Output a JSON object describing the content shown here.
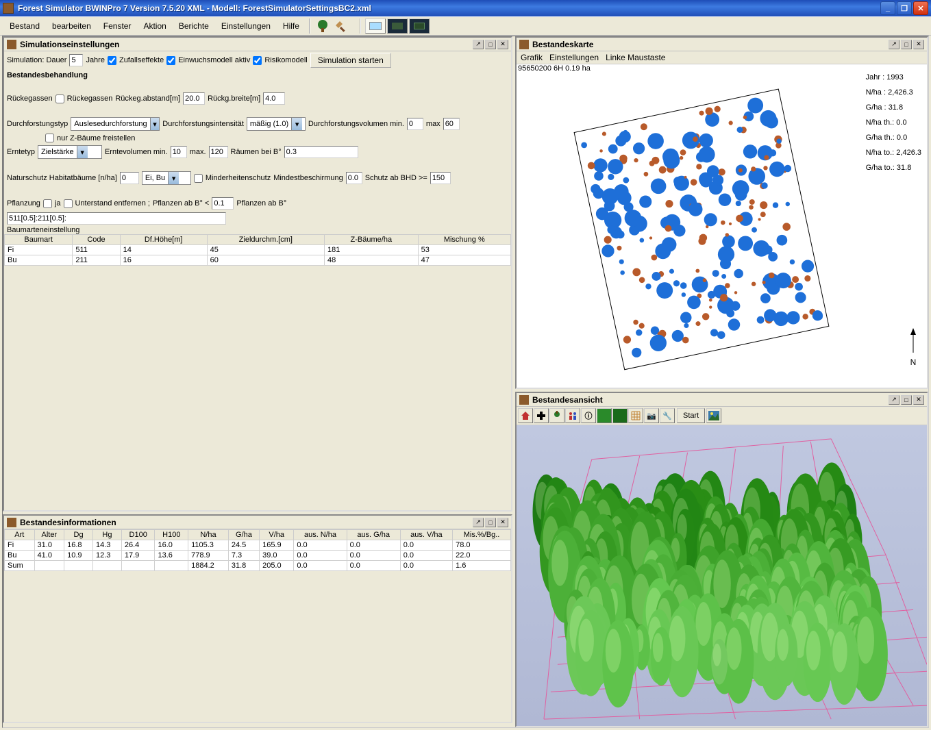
{
  "window": {
    "title": "Forest Simulator BWINPro 7 Version 7.5.20 XML - Modell: ForestSimulatorSettingsBC2.xml"
  },
  "menubar": [
    "Bestand",
    "bearbeiten",
    "Fenster",
    "Aktion",
    "Berichte",
    "Einstellungen",
    "Hilfe"
  ],
  "sim": {
    "panel_title": "Simulationseinstellungen",
    "dauer_label": "Simulation: Dauer",
    "dauer_value": "5",
    "jahre_label": "Jahre",
    "zufall": "Zufallseffekte",
    "einwuchs": "Einwuchsmodell aktiv",
    "risiko": "Risikomodell",
    "start_btn": "Simulation starten",
    "behandlung": "Bestandesbehandlung",
    "rueckegassen": "Rückegassen",
    "rueckegassen_cb": "Rückegassen",
    "rueckeg_abstand_l": "Rückeg.abstand[m]",
    "rueckeg_abstand_v": "20.0",
    "rueckg_breite_l": "Rückg.breite[m]",
    "rueckg_breite_v": "4.0",
    "durchforstungstyp_l": "Durchforstungstyp",
    "durchforstungstyp_v": "Auslesedurchforstung",
    "durchforst_int_l": "Durchforstungsintensität",
    "durchforst_int_v": "mäßig (1.0)",
    "durchforst_vol_l": "Durchforstungsvolumen min.",
    "durchforst_vol_min": "0",
    "durchforst_vol_max_l": "max",
    "durchforst_vol_max": "60",
    "nurz": "nur Z-Bäume freistellen",
    "erntetyp_l": "Erntetyp",
    "erntetyp_v": "Zielstärke",
    "erntevol_min_l": "Erntevolumen min.",
    "erntevol_min": "10",
    "erntevol_max_l": "max.",
    "erntevol_max": "120",
    "raeumen_l": "Räumen bei B°",
    "raeumen_v": "0.3",
    "naturschutz_l": "Naturschutz Habitatbäume [n/ha]",
    "naturschutz_v": "0",
    "eibu": "Ei, Bu",
    "minderheit": "Minderheitenschutz",
    "mindestbeschirmung_l": "Mindestbeschirmung",
    "mindestbeschirmung_v": "0.0",
    "schutzbhd_l": "Schutz ab BHD >=",
    "schutzbhd_v": "150",
    "pflanzung_l": "Pflanzung",
    "ja_l": "ja",
    "unterstand_l": "Unterstand entfernen ;",
    "pflanzen_ab_l": "Pflanzen ab B°  <",
    "pflanzen_ab_v": "0.1",
    "pflanzen_ab_b_l": "Pflanzen ab B°",
    "pflanzen_txt": "511[0.5]:211[0.5]:",
    "baumarten_l": "Baumarteneinstellung",
    "table_headers": [
      "Baumart",
      "Code",
      "Df.Höhe[m]",
      "Zieldurchm.[cm]",
      "Z-Bäume/ha",
      "Mischung %"
    ],
    "table_rows": [
      [
        "Fi",
        "511",
        "14",
        "45",
        "181",
        "53"
      ],
      [
        "Bu",
        "211",
        "16",
        "60",
        "48",
        "47"
      ]
    ]
  },
  "info": {
    "panel_title": "Bestandesinformationen",
    "headers": [
      "Art",
      "Alter",
      "Dg",
      "Hg",
      "D100",
      "H100",
      "N/ha",
      "G/ha",
      "V/ha",
      "aus. N/ha",
      "aus. G/ha",
      "aus. V/ha",
      "Mis.%/Bg.."
    ],
    "rows": [
      [
        "Fi",
        "31.0",
        "16.8",
        "14.3",
        "26.4",
        "16.0",
        "1105.3",
        "24.5",
        "165.9",
        "0.0",
        "0.0",
        "0.0",
        "78.0"
      ],
      [
        "Bu",
        "41.0",
        "10.9",
        "12.3",
        "17.9",
        "13.6",
        "778.9",
        "7.3",
        "39.0",
        "0.0",
        "0.0",
        "0.0",
        "22.0"
      ],
      [
        "Sum",
        "",
        "",
        "",
        "",
        "",
        "1884.2",
        "31.8",
        "205.0",
        "0.0",
        "0.0",
        "0.0",
        "1.6"
      ]
    ]
  },
  "map": {
    "panel_title": "Bestandeskarte",
    "menus": [
      "Grafik",
      "Einstellungen",
      "Linke Maustaste"
    ],
    "plot_id": "95650200 6H  0.19 ha",
    "stats": {
      "jahr_l": "Jahr :",
      "jahr_v": "1993",
      "nha_l": "N/ha  :",
      "nha_v": "2,426.3",
      "gha_l": "G/ha  :",
      "gha_v": "31.8",
      "nhath_l": "N/ha th.:",
      "nhath_v": "0.0",
      "ghath_l": "G/ha th.:",
      "ghath_v": "0.0",
      "nhato_l": "N/ha to.:",
      "nhato_v": "2,426.3",
      "ghato_l": "G/ha to.:",
      "ghato_v": "31.8"
    },
    "compass": "N"
  },
  "view": {
    "panel_title": "Bestandesansicht",
    "start_btn": "Start"
  }
}
